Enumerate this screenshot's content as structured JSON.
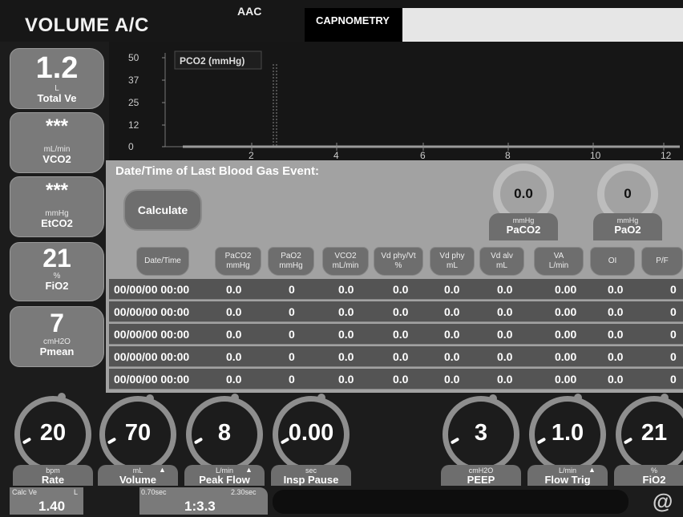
{
  "header": {
    "mode_title": "VOLUME A/C",
    "sub_mode": "AAC",
    "tab_active": "CAPNOMETRY"
  },
  "monitors": [
    {
      "value": "1.2",
      "unit": "L",
      "name": "Total Ve"
    },
    {
      "value": "***",
      "unit": "mL/min",
      "name": "VCO2"
    },
    {
      "value": "***",
      "unit": "mmHg",
      "name": "EtCO2"
    },
    {
      "value": "21",
      "unit": "%",
      "name": "FiO2"
    },
    {
      "value": "7",
      "unit": "cmH2O",
      "name": "Pmean"
    }
  ],
  "plot": {
    "label": "PCO2 (mmHg)",
    "y_ticks": [
      "50",
      "37",
      "25",
      "12",
      "0"
    ],
    "x_ticks": [
      "2",
      "4",
      "6",
      "8",
      "10",
      "12"
    ]
  },
  "blood_gas": {
    "title": "Date/Time of Last Blood Gas Event:",
    "calculate_label": "Calculate",
    "paco2": {
      "value": "0.0",
      "unit": "mmHg",
      "name": "PaCO2"
    },
    "pao2": {
      "value": "0",
      "unit": "mmHg",
      "name": "PaO2"
    }
  },
  "table": {
    "headers": [
      {
        "l1": "Date/Time",
        "l2": ""
      },
      {
        "l1": "PaCO2",
        "l2": "mmHg"
      },
      {
        "l1": "PaO2",
        "l2": "mmHg"
      },
      {
        "l1": "VCO2",
        "l2": "mL/min"
      },
      {
        "l1": "Vd phy/Vt",
        "l2": "%"
      },
      {
        "l1": "Vd phy",
        "l2": "mL"
      },
      {
        "l1": "Vd alv",
        "l2": "mL"
      },
      {
        "l1": "VA",
        "l2": "L/min"
      },
      {
        "l1": "OI",
        "l2": ""
      },
      {
        "l1": "P/F",
        "l2": ""
      }
    ],
    "rows": [
      [
        "00/00/00 00:00",
        "0.0",
        "0",
        "0.0",
        "0.0",
        "0.0",
        "0.0",
        "0.00",
        "0.0",
        "0"
      ],
      [
        "00/00/00 00:00",
        "0.0",
        "0",
        "0.0",
        "0.0",
        "0.0",
        "0.0",
        "0.00",
        "0.0",
        "0"
      ],
      [
        "00/00/00 00:00",
        "0.0",
        "0",
        "0.0",
        "0.0",
        "0.0",
        "0.0",
        "0.00",
        "0.0",
        "0"
      ],
      [
        "00/00/00 00:00",
        "0.0",
        "0",
        "0.0",
        "0.0",
        "0.0",
        "0.0",
        "0.00",
        "0.0",
        "0"
      ],
      [
        "00/00/00 00:00",
        "0.0",
        "0",
        "0.0",
        "0.0",
        "0.0",
        "0.0",
        "0.00",
        "0.0",
        "0"
      ]
    ]
  },
  "controls": [
    {
      "value": "20",
      "unit": "bpm",
      "name": "Rate",
      "arrow": ""
    },
    {
      "value": "70",
      "unit": "mL",
      "name": "Volume",
      "arrow": "▲"
    },
    {
      "value": "8",
      "unit": "L/min",
      "name": "Peak Flow",
      "arrow": "▲"
    },
    {
      "value": "0.00",
      "unit": "sec",
      "name": "Insp Pause",
      "arrow": ""
    },
    {
      "value": "3",
      "unit": "cmH2O",
      "name": "PEEP",
      "arrow": ""
    },
    {
      "value": "1.0",
      "unit": "L/min",
      "name": "Flow Trig",
      "arrow": "▲"
    },
    {
      "value": "21",
      "unit": "%",
      "name": "FiO2",
      "arrow": ""
    }
  ],
  "footer": {
    "calc_ve_label": "Calc Ve",
    "calc_ve_unit": "L",
    "calc_ve_value": "1.40",
    "insp_time": "0.70sec",
    "exp_time": "2.30sec",
    "ie_ratio": "1:3.3",
    "status_text": "",
    "logo_glyph": "@"
  },
  "colors": {
    "background": "#1c1c1c",
    "panel_gray": "#a2a2a2",
    "tile_gray": "#7a7a7a",
    "header_gray": "#6e6e6e",
    "ring_gray": "#8e8e8e"
  }
}
